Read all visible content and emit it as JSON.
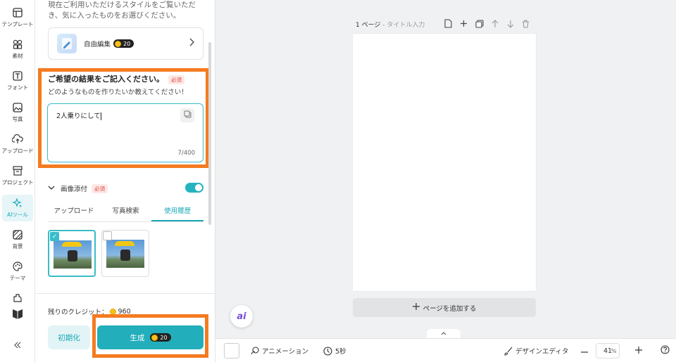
{
  "rail": {
    "items": [
      {
        "label": "テンプレート",
        "icon": "template-icon"
      },
      {
        "label": "素材",
        "icon": "elements-icon"
      },
      {
        "label": "フォント",
        "icon": "font-icon"
      },
      {
        "label": "写真",
        "icon": "photo-icon"
      },
      {
        "label": "アップロード",
        "icon": "upload-icon"
      },
      {
        "label": "プロジェクト",
        "icon": "project-icon"
      },
      {
        "label": "AIツール",
        "icon": "ai-tool-icon",
        "active": true
      },
      {
        "label": "背景",
        "icon": "background-icon"
      },
      {
        "label": "テーマ",
        "icon": "theme-icon"
      }
    ]
  },
  "panel": {
    "intro": "現在ご利用いただけるスタイルをご覧いただき、気に入ったものをお選びください。",
    "free_edit": {
      "label": "自由編集",
      "cost": "20"
    },
    "result": {
      "title": "ご希望の結果をご記入ください。",
      "required": "必須",
      "subtitle": "どのようなものを作りたいか教えてください！",
      "value": "2人乗りにして",
      "counter": "7/400"
    },
    "image_attach": {
      "label": "画像添付",
      "required": "必須"
    },
    "tabs": [
      {
        "label": "アップロード"
      },
      {
        "label": "写真検索"
      },
      {
        "label": "使用履歴",
        "active": true
      }
    ],
    "credits": {
      "label": "残りのクレジット：",
      "value": "960"
    },
    "reset_label": "初期化",
    "generate": {
      "label": "生成",
      "cost": "20"
    }
  },
  "canvas": {
    "page_title": "1 ページ",
    "page_subtitle": "- タイトル入力",
    "add_page": "ページを追加する",
    "ai_fab": "ai"
  },
  "bottombar": {
    "animation": "アニメーション",
    "duration": "5秒",
    "design_editor": "デザインエディタ",
    "zoom": "41",
    "zoom_unit": "%"
  },
  "colors": {
    "accent": "#22aebb",
    "highlight": "#f47b20"
  }
}
